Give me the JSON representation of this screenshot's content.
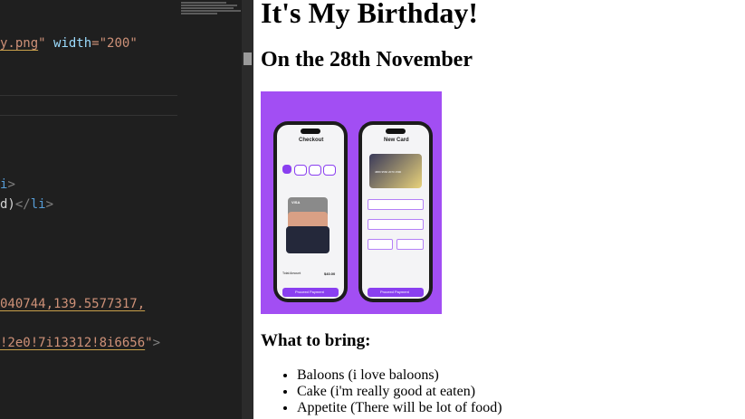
{
  "editor": {
    "lines": [
      {
        "parts": [
          {
            "t": "y.png",
            "c": "tok-str",
            "u": true
          },
          {
            "t": "\" ",
            "c": "tok-str"
          },
          {
            "t": "width",
            "c": "tok-attr"
          },
          {
            "t": "=\"200\"",
            "c": "tok-str"
          }
        ]
      },
      {
        "parts": [
          {
            "t": "i",
            "c": "tok-tag"
          },
          {
            "t": ">",
            "c": "tok-bracket"
          }
        ]
      },
      {
        "parts": [
          {
            "t": "d)",
            "c": "tok-txt"
          },
          {
            "t": "</",
            "c": "tok-bracket"
          },
          {
            "t": "li",
            "c": "tok-tag"
          },
          {
            "t": ">",
            "c": "tok-bracket"
          }
        ]
      },
      {
        "parts": [
          {
            "t": "040744,139.5577317,",
            "c": "tok-str",
            "u": true
          }
        ]
      },
      {
        "parts": [
          {
            "t": "!2e0!7i13312!8i6656",
            "c": "tok-str",
            "u": true
          },
          {
            "t": "\"",
            "c": "tok-str"
          },
          {
            "t": ">",
            "c": "tok-bracket"
          }
        ]
      }
    ]
  },
  "page": {
    "title": "It's My Birthday!",
    "subtitle": "On the 28th November",
    "bring_heading": "What to bring:",
    "bring_items": [
      "Baloons (i love baloons)",
      "Cake (i'm really good at eaten)",
      "Appetite (There will be lot of food)"
    ]
  },
  "hero": {
    "checkout_title": "Checkout",
    "newcard_title": "New Card",
    "visa": "VISA",
    "total_label": "Total Amount",
    "total_value": "$40.00",
    "proceed_label": "Proceed Payment",
    "card_number": "4880 9560 2070 1590",
    "colors": {
      "bg": "#a24ef3",
      "accent": "#8a3ff0"
    }
  }
}
